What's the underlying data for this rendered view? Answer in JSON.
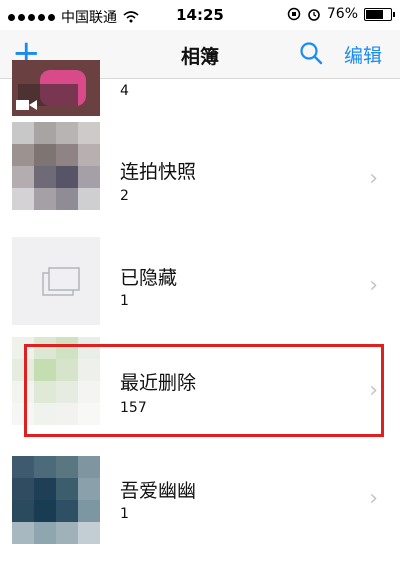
{
  "status": {
    "carrier": "中国联通",
    "time": "14:25",
    "battery": "76%",
    "battery_level": 0.76
  },
  "nav": {
    "title": "相簿",
    "add_icon": "plus-icon",
    "search_icon": "search-icon",
    "edit_label": "编辑"
  },
  "albums": [
    {
      "title": "",
      "count": "4"
    },
    {
      "title": "连拍快照",
      "count": "2"
    },
    {
      "title": "已隐藏",
      "count": "1"
    },
    {
      "title": "最近删除",
      "count": "157"
    },
    {
      "title": "吾爱幽幽",
      "count": "1"
    }
  ],
  "colors": {
    "accent": "#1a8cf0",
    "highlight": "#e02020"
  }
}
